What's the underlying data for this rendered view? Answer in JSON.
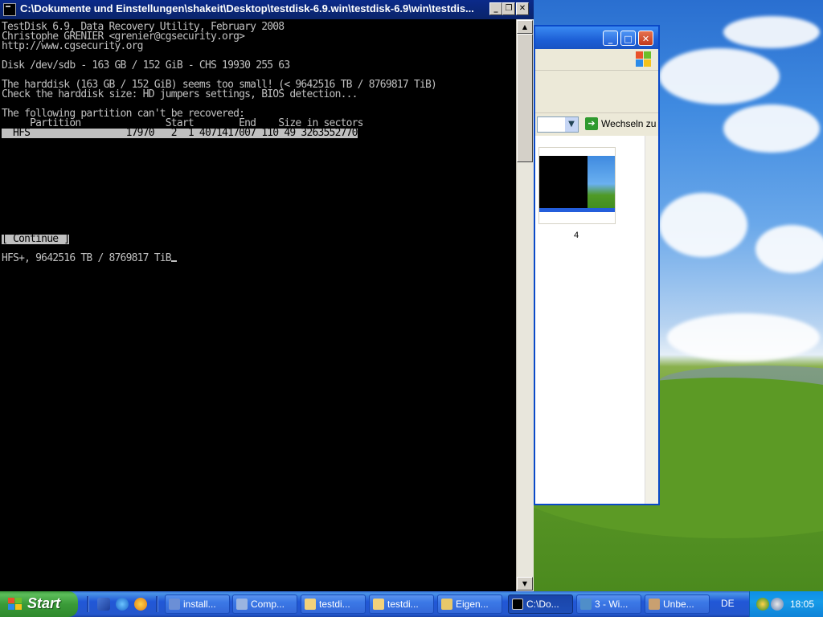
{
  "console": {
    "title": "C:\\Dokumente und Einstellungen\\shakeit\\Desktop\\testdisk-6.9.win\\testdisk-6.9\\win\\testdis...",
    "buttons": {
      "minimize": "_",
      "restore": "❐",
      "close": "✕"
    },
    "lines": {
      "l1": "TestDisk 6.9, Data Recovery Utility, February 2008",
      "l2": "Christophe GRENIER <grenier@cgsecurity.org>",
      "l3": "http://www.cgsecurity.org",
      "l4": "Disk /dev/sdb - 163 GB / 152 GiB - CHS 19930 255 63",
      "l5": "The harddisk (163 GB / 152 GiB) seems too small! (< 9642516 TB / 8769817 TiB)",
      "l6": "Check the harddisk size: HD jumpers settings, BIOS detection...",
      "l7": "The following partition can't be recovered:",
      "header": "     Partition               Start        End    Size in sectors",
      "row": "  HFS                 17970   2  1 4071417007 110 49 3263552770",
      "continue": "[ Continue ]",
      "status": "HFS+, 9642516 TB / 8769817 TiB"
    }
  },
  "explorer": {
    "go_label": "Wechseln zu",
    "thumbnail_label": "4"
  },
  "taskbar": {
    "start_label": "Start",
    "buttons": [
      {
        "label": "install..."
      },
      {
        "label": "Comp..."
      },
      {
        "label": "testdi..."
      },
      {
        "label": "testdi..."
      },
      {
        "label": "Eigen..."
      },
      {
        "label": "C:\\Do..."
      },
      {
        "label": "3 - Wi..."
      },
      {
        "label": "Unbe..."
      }
    ],
    "language": "DE",
    "clock": "18:05"
  }
}
